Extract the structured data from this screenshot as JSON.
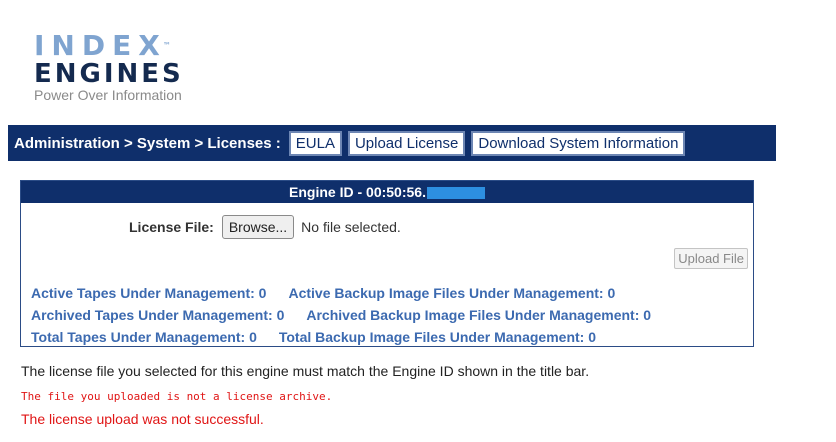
{
  "logo": {
    "line1": "INDEX",
    "trademark": "™",
    "line2": "ENGINES",
    "tagline": "Power Over Information"
  },
  "nav": {
    "breadcrumb": "Administration > System > Licenses :",
    "tabs": [
      "EULA",
      "Upload License",
      "Download System Information"
    ]
  },
  "panel": {
    "title": "Engine ID - 00:50:56.",
    "license_file_label": "License File:",
    "browse_label": "Browse...",
    "no_file_text": "No file selected.",
    "upload_button": "Upload File",
    "stats": {
      "active_tapes": "Active Tapes Under Management: 0",
      "active_backup": "Active Backup Image Files Under Management: 0",
      "archived_tapes": "Archived Tapes Under Management: 0",
      "archived_backup": "Archived Backup Image Files Under Management: 0",
      "total_tapes": "Total Tapes Under Management: 0",
      "total_backup": "Total Backup Image Files Under Management: 0"
    }
  },
  "messages": {
    "info": "The license file you selected for this engine must match the Engine ID shown in the title bar.",
    "error_detail": "The file you uploaded is not a license archive.",
    "error": "The license upload was not successful."
  },
  "colors": {
    "nav_bg": "#0f2f6b",
    "stats_text": "#3c6ab0",
    "error": "#e01515"
  }
}
